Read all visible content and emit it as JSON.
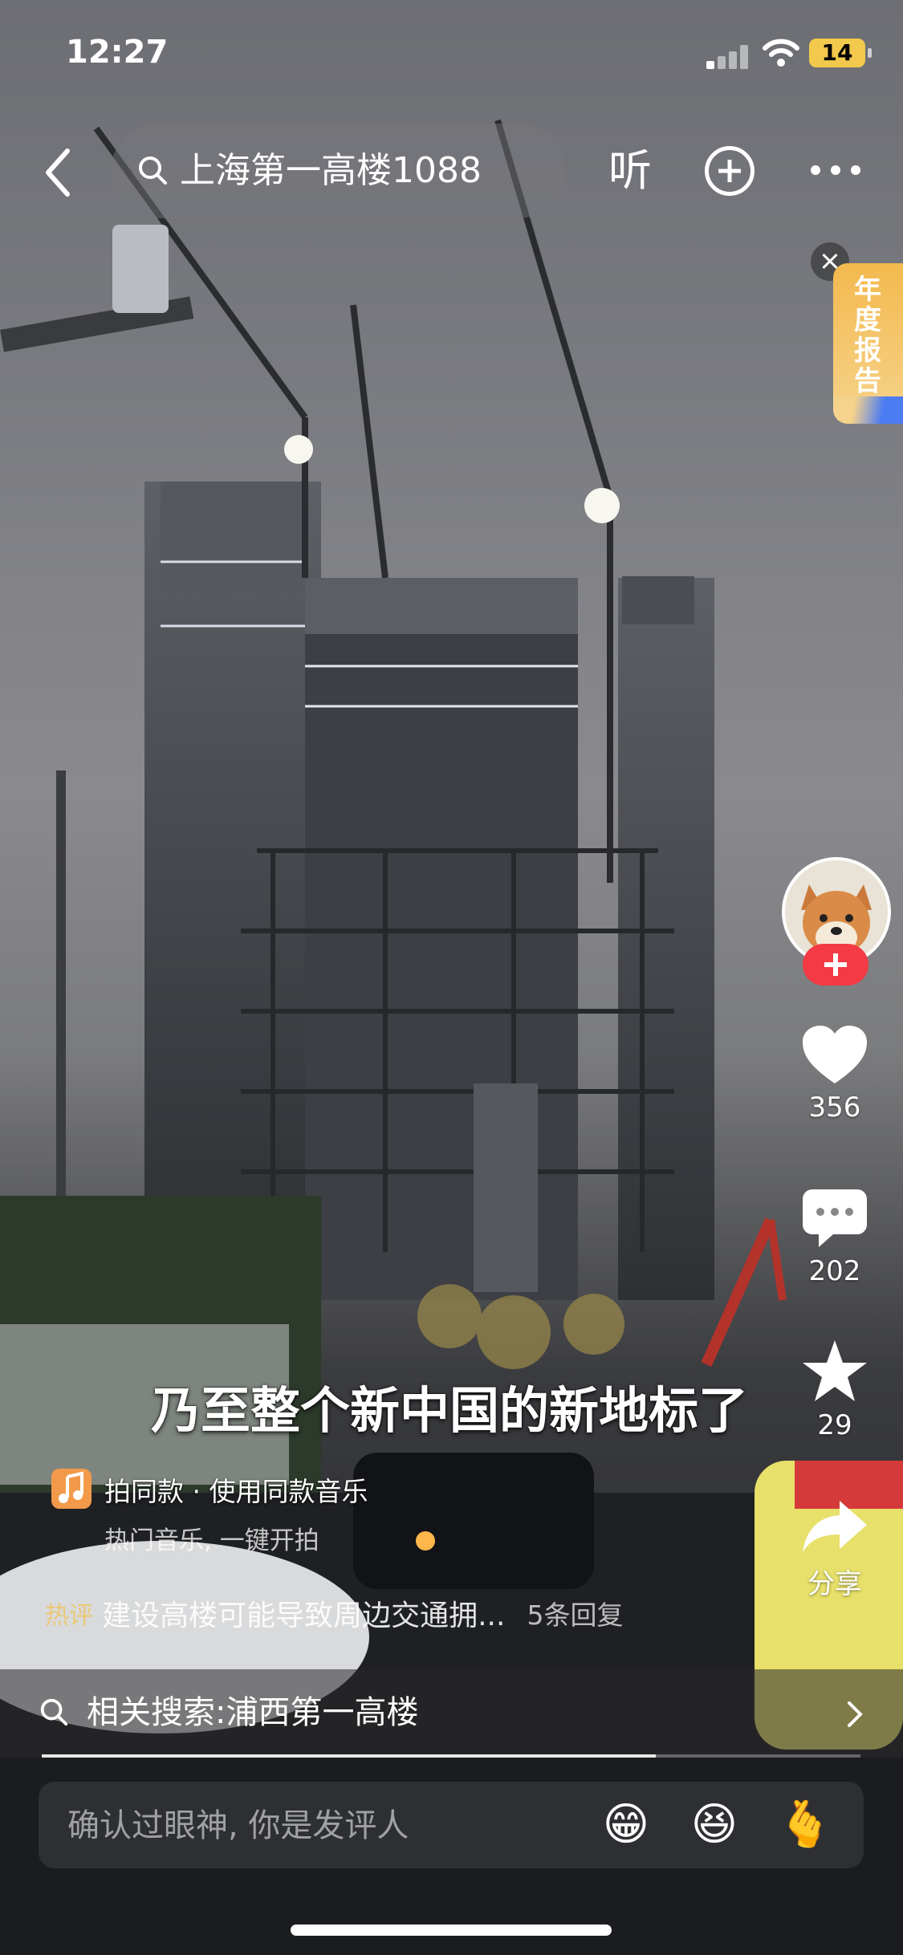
{
  "status_bar": {
    "time": "12:27",
    "battery": "14"
  },
  "top_nav": {
    "search_query": "上海第一高楼1088",
    "listen_label": "听"
  },
  "annual_report": {
    "label": "年度报告"
  },
  "right_rail": {
    "like_count": "356",
    "comment_count": "202",
    "favorite_count": "29",
    "share_label": "分享"
  },
  "subtitle": "乃至整个新中国的新地标了",
  "music": {
    "title": "拍同款 · 使用同款音乐",
    "subtitle": "热门音乐, 一键开拍"
  },
  "comment_preview": {
    "tag": "热评",
    "text": "建设高楼可能导致周边交通拥...",
    "replies": "5条回复"
  },
  "related_search": {
    "label": "相关搜索:浦西第一高楼"
  },
  "progress": {
    "fraction": 0.75
  },
  "comment_input": {
    "placeholder": "确认过眼神, 你是发评人"
  },
  "emojis": [
    "😁",
    "😆",
    "🫰"
  ],
  "colors": {
    "accent": "#f33a45",
    "report_gold": "#f3b94e",
    "music_orange": "#f29a4a"
  }
}
